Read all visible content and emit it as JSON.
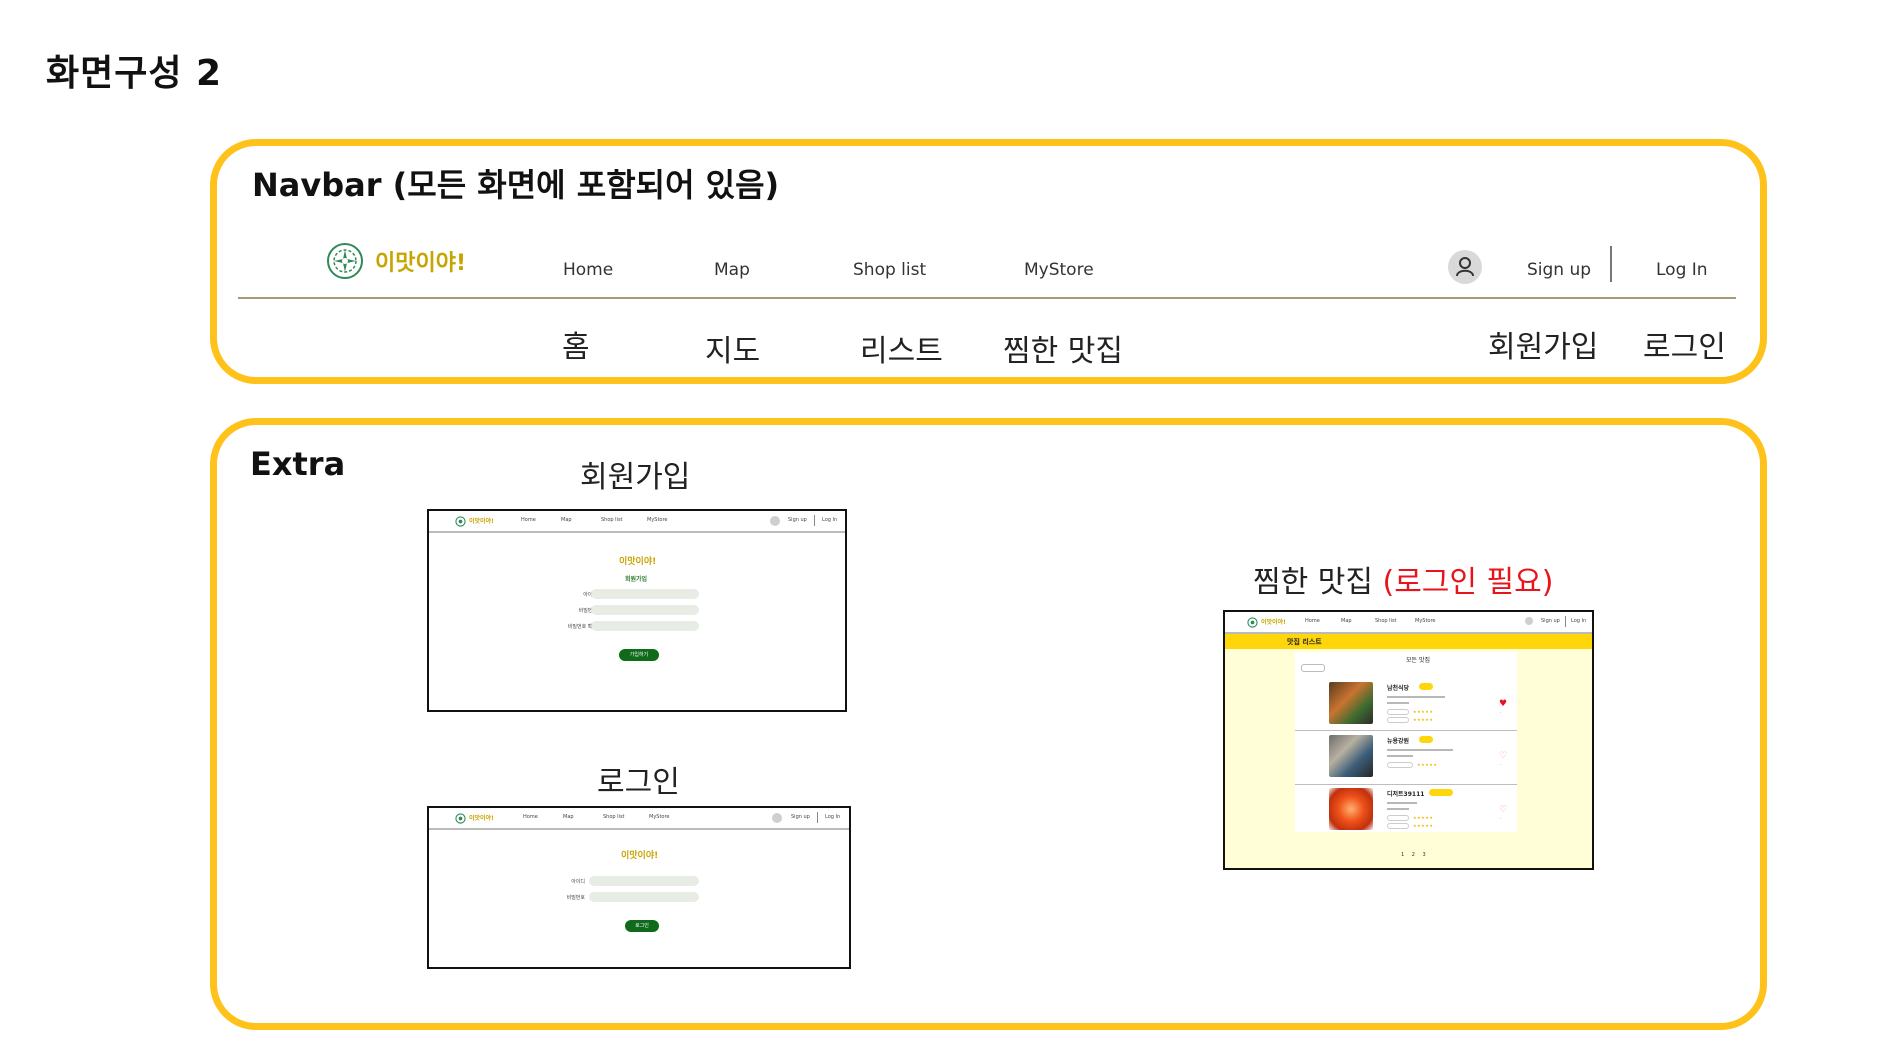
{
  "page_title": "화면구성 2",
  "navbar_panel": {
    "heading": "Navbar (모든 화면에 포함되어 있음)",
    "logo_text": "이맛이야!",
    "links": [
      "Home",
      "Map",
      "Shop list",
      "MyStore"
    ],
    "signup_label": "Sign up",
    "login_label": "Log In",
    "captions": [
      "홈",
      "지도",
      "리스트",
      "찜한 맛집",
      "회원가입",
      "로그인"
    ]
  },
  "extra_panel": {
    "heading": "Extra",
    "signup_caption": "회원가입",
    "login_caption": "로그인",
    "favorites_caption": "찜한 맛집",
    "favorites_caption_note": "(로그인 필요)",
    "mini_nav": {
      "logo_text": "이맛이야!",
      "links": [
        "Home",
        "Map",
        "Shop list",
        "MyStore"
      ],
      "signup_label": "Sign up",
      "login_label": "Log In"
    },
    "signup_screen": {
      "brand": "이맛이야!",
      "subtitle": "회원가입",
      "labels": [
        "아이디",
        "비밀번호",
        "비밀번호 확인"
      ],
      "button": "가입하기"
    },
    "login_screen": {
      "brand": "이맛이야!",
      "labels": [
        "아이디",
        "비밀번호"
      ],
      "button": "로그인"
    },
    "favorites_screen": {
      "bar_title": "맛집 리스트",
      "list_title": "모든 맛집",
      "shops": [
        "남천식당",
        "뉴용강원",
        "디저트39111"
      ],
      "pager": "1 2 3"
    }
  },
  "colors": {
    "panel_border": "#ffc21a",
    "favorite_red": "#e8141b",
    "brand_gold": "#c8a400",
    "button_green": "#0f6b1a",
    "highlight_yellow": "#ffd60a"
  },
  "icons": {
    "logo": "leaf-wreath-icon",
    "user": "user-icon",
    "favorite": "heart-icon"
  }
}
